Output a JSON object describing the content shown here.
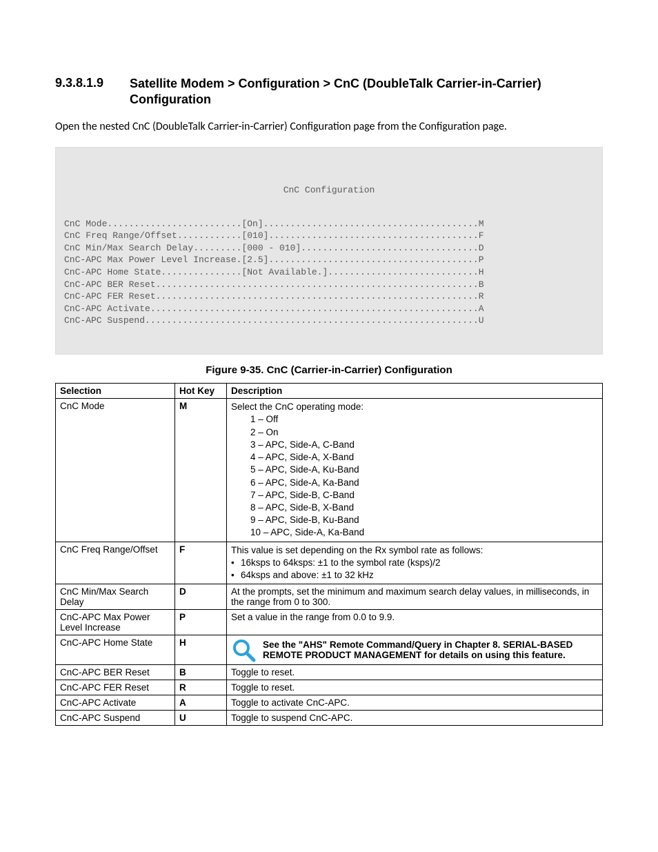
{
  "section": {
    "number": "9.3.8.1.9",
    "title": "Satellite Modem > Configuration > CnC (DoubleTalk Carrier-in-Carrier) Configuration"
  },
  "intro": "Open the nested CnC (DoubleTalk Carrier-in-Carrier) Configuration page from the Configuration page.",
  "terminal": {
    "title": "CnC Configuration",
    "lines": [
      "CnC Mode.........................[On]........................................M",
      "CnC Freq Range/Offset............[010].......................................F",
      "CnC Min/Max Search Delay.........[000 - 010].................................D",
      "CnC-APC Max Power Level Increase.[2.5].......................................P",
      "CnC-APC Home State...............[Not Available.]............................H",
      "CnC-APC BER Reset............................................................B",
      "CnC-APC FER Reset............................................................R",
      "CnC-APC Activate.............................................................A",
      "CnC-APC Suspend..............................................................U"
    ]
  },
  "figure_caption": "Figure 9-35. CnC (Carrier-in-Carrier) Configuration",
  "table": {
    "headers": {
      "selection": "Selection",
      "hotkey": "Hot Key",
      "description": "Description"
    },
    "rows": [
      {
        "selection": "CnC Mode",
        "hotkey": "M",
        "desc_lead": "Select the CnC operating mode:",
        "desc_options": [
          "1 – Off",
          "2 – On",
          "3 – APC, Side-A, C-Band",
          "4 – APC, Side-A, X-Band",
          "5 – APC, Side-A, Ku-Band",
          "6 – APC, Side-A, Ka-Band",
          "7 – APC, Side-B, C-Band",
          "8 – APC, Side-B, X-Band",
          "9 – APC, Side-B, Ku-Band",
          "10 – APC, Side-A, Ka-Band"
        ]
      },
      {
        "selection": "CnC Freq Range/Offset",
        "hotkey": "F",
        "desc_lead": "This value is set depending on the Rx symbol rate as follows:",
        "desc_bullets": [
          "16ksps to 64ksps: ±1 to the symbol rate (ksps)/2",
          "64ksps and above: ±1 to 32 kHz"
        ]
      },
      {
        "selection": "CnC Min/Max Search Delay",
        "hotkey": "D",
        "desc_text": "At the prompts, set the minimum and maximum search delay values, in milliseconds, in the range from 0 to 300."
      },
      {
        "selection": "CnC-APC Max Power Level Increase",
        "hotkey": "P",
        "desc_text": "Set a value in the range from 0.0 to 9.9."
      },
      {
        "selection": "CnC-APC Home State",
        "hotkey": "H",
        "desc_note": "See the \"AHS\" Remote Command/Query in Chapter 8. SERIAL-BASED REMOTE PRODUCT MANAGEMENT for details on using this feature."
      },
      {
        "selection": "CnC-APC BER Reset",
        "hotkey": "B",
        "desc_text": "Toggle to reset."
      },
      {
        "selection": "CnC-APC FER Reset",
        "hotkey": "R",
        "desc_text": "Toggle to reset."
      },
      {
        "selection": "CnC-APC Activate",
        "hotkey": "A",
        "desc_text": "Toggle to activate CnC-APC."
      },
      {
        "selection": "CnC-APC Suspend",
        "hotkey": "U",
        "desc_text": "Toggle to suspend CnC-APC."
      }
    ]
  }
}
